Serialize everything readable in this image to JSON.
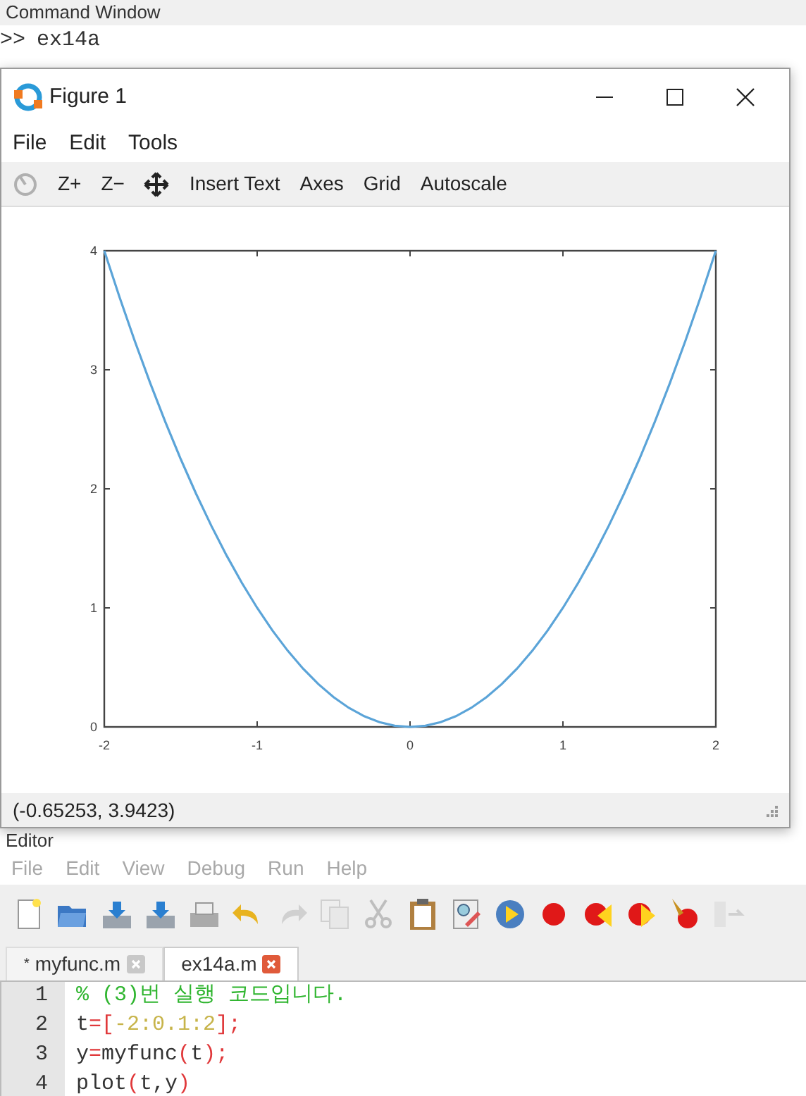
{
  "command_window": {
    "title": "Command Window",
    "prompt": ">>",
    "command": "ex14a"
  },
  "figure": {
    "title": "Figure 1",
    "menu": [
      "File",
      "Edit",
      "Tools"
    ],
    "toolbar": [
      {
        "kind": "rotate",
        "disabled": true
      },
      {
        "kind": "text",
        "label": "Z+",
        "disabled": false
      },
      {
        "kind": "text",
        "label": "Z−",
        "disabled": false
      },
      {
        "kind": "pan",
        "disabled": false
      },
      {
        "kind": "text",
        "label": "Insert Text",
        "disabled": false
      },
      {
        "kind": "text",
        "label": "Axes",
        "disabled": false
      },
      {
        "kind": "text",
        "label": "Grid",
        "disabled": false
      },
      {
        "kind": "text",
        "label": "Autoscale",
        "disabled": false
      }
    ],
    "chart_data": {
      "type": "line",
      "x": [
        -2,
        -1.9,
        -1.8,
        -1.7,
        -1.6,
        -1.5,
        -1.4,
        -1.3,
        -1.2,
        -1.1,
        -1,
        -0.9,
        -0.8,
        -0.7,
        -0.6,
        -0.5,
        -0.4,
        -0.3,
        -0.2,
        -0.1,
        0,
        0.1,
        0.2,
        0.3,
        0.4,
        0.5,
        0.6,
        0.7,
        0.8,
        0.9,
        1,
        1.1,
        1.2,
        1.3,
        1.4,
        1.5,
        1.6,
        1.7,
        1.8,
        1.9,
        2
      ],
      "series": [
        {
          "color": "#5ba4d8",
          "values": [
            4,
            3.61,
            3.24,
            2.89,
            2.56,
            2.25,
            1.96,
            1.69,
            1.44,
            1.21,
            1,
            0.81,
            0.64,
            0.49,
            0.36,
            0.25,
            0.16,
            0.09,
            0.04,
            0.01,
            0,
            0.01,
            0.04,
            0.09,
            0.16,
            0.25,
            0.36,
            0.49,
            0.64,
            0.81,
            1,
            1.21,
            1.44,
            1.69,
            1.96,
            2.25,
            2.56,
            2.89,
            3.24,
            3.61,
            4
          ]
        }
      ],
      "xlim": [
        -2,
        2
      ],
      "ylim": [
        0,
        4
      ],
      "xticks": [
        -2,
        -1,
        0,
        1,
        2
      ],
      "yticks": [
        0,
        1,
        2,
        3,
        4
      ]
    },
    "status": "(-0.65253, 3.9423)"
  },
  "editor": {
    "title": "Editor",
    "menu": [
      "File",
      "Edit",
      "View",
      "Debug",
      "Run",
      "Help"
    ],
    "toolbar": [
      {
        "kind": "new",
        "disabled": false
      },
      {
        "kind": "open",
        "disabled": false
      },
      {
        "kind": "save",
        "disabled": false
      },
      {
        "kind": "save-as",
        "disabled": false
      },
      {
        "kind": "print",
        "disabled": false
      },
      {
        "kind": "undo",
        "disabled": false
      },
      {
        "kind": "redo",
        "disabled": true
      },
      {
        "kind": "copy",
        "disabled": true
      },
      {
        "kind": "cut",
        "disabled": true
      },
      {
        "kind": "paste",
        "disabled": false
      },
      {
        "kind": "find",
        "disabled": false
      },
      {
        "kind": "run",
        "disabled": false
      },
      {
        "kind": "breakpoint",
        "disabled": false
      },
      {
        "kind": "prev-breakpoint",
        "disabled": false
      },
      {
        "kind": "next-breakpoint",
        "disabled": false
      },
      {
        "kind": "clear-breakpoints",
        "disabled": false
      },
      {
        "kind": "step",
        "disabled": true
      }
    ],
    "tabs": [
      {
        "label": "myfunc.m",
        "modified_mark": "*",
        "selected": false
      },
      {
        "label": "ex14a.m",
        "selected": true
      }
    ],
    "lines": [
      {
        "number": "1",
        "tokens": [
          {
            "kind": "comment",
            "text": "% (3)번 실행 코드입니다."
          }
        ]
      },
      {
        "number": "2",
        "tokens": [
          {
            "kind": "ident",
            "text": "t"
          },
          {
            "kind": "op",
            "text": "=["
          },
          {
            "kind": "num",
            "text": "-2:0.1:2"
          },
          {
            "kind": "op",
            "text": "];"
          }
        ]
      },
      {
        "number": "3",
        "tokens": [
          {
            "kind": "ident",
            "text": "y"
          },
          {
            "kind": "op",
            "text": "="
          },
          {
            "kind": "ident",
            "text": "myfunc"
          },
          {
            "kind": "op",
            "text": "("
          },
          {
            "kind": "ident",
            "text": "t"
          },
          {
            "kind": "op",
            "text": ");"
          }
        ]
      },
      {
        "number": "4",
        "tokens": [
          {
            "kind": "ident",
            "text": "plot"
          },
          {
            "kind": "op",
            "text": "("
          },
          {
            "kind": "ident",
            "text": "t,y"
          },
          {
            "kind": "op",
            "text": ")"
          }
        ]
      }
    ]
  }
}
